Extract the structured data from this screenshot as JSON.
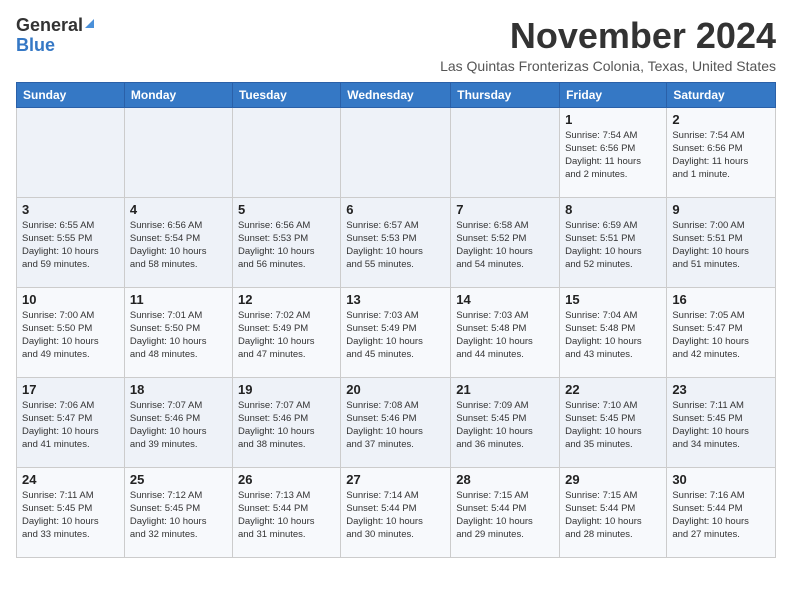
{
  "header": {
    "logo_line1": "General",
    "logo_line2": "Blue",
    "month": "November 2024",
    "location": "Las Quintas Fronterizas Colonia, Texas, United States"
  },
  "weekdays": [
    "Sunday",
    "Monday",
    "Tuesday",
    "Wednesday",
    "Thursday",
    "Friday",
    "Saturday"
  ],
  "weeks": [
    [
      {
        "day": "",
        "info": ""
      },
      {
        "day": "",
        "info": ""
      },
      {
        "day": "",
        "info": ""
      },
      {
        "day": "",
        "info": ""
      },
      {
        "day": "",
        "info": ""
      },
      {
        "day": "1",
        "info": "Sunrise: 7:54 AM\nSunset: 6:56 PM\nDaylight: 11 hours\nand 2 minutes."
      },
      {
        "day": "2",
        "info": "Sunrise: 7:54 AM\nSunset: 6:56 PM\nDaylight: 11 hours\nand 1 minute."
      }
    ],
    [
      {
        "day": "3",
        "info": "Sunrise: 6:55 AM\nSunset: 5:55 PM\nDaylight: 10 hours\nand 59 minutes."
      },
      {
        "day": "4",
        "info": "Sunrise: 6:56 AM\nSunset: 5:54 PM\nDaylight: 10 hours\nand 58 minutes."
      },
      {
        "day": "5",
        "info": "Sunrise: 6:56 AM\nSunset: 5:53 PM\nDaylight: 10 hours\nand 56 minutes."
      },
      {
        "day": "6",
        "info": "Sunrise: 6:57 AM\nSunset: 5:53 PM\nDaylight: 10 hours\nand 55 minutes."
      },
      {
        "day": "7",
        "info": "Sunrise: 6:58 AM\nSunset: 5:52 PM\nDaylight: 10 hours\nand 54 minutes."
      },
      {
        "day": "8",
        "info": "Sunrise: 6:59 AM\nSunset: 5:51 PM\nDaylight: 10 hours\nand 52 minutes."
      },
      {
        "day": "9",
        "info": "Sunrise: 7:00 AM\nSunset: 5:51 PM\nDaylight: 10 hours\nand 51 minutes."
      }
    ],
    [
      {
        "day": "10",
        "info": "Sunrise: 7:00 AM\nSunset: 5:50 PM\nDaylight: 10 hours\nand 49 minutes."
      },
      {
        "day": "11",
        "info": "Sunrise: 7:01 AM\nSunset: 5:50 PM\nDaylight: 10 hours\nand 48 minutes."
      },
      {
        "day": "12",
        "info": "Sunrise: 7:02 AM\nSunset: 5:49 PM\nDaylight: 10 hours\nand 47 minutes."
      },
      {
        "day": "13",
        "info": "Sunrise: 7:03 AM\nSunset: 5:49 PM\nDaylight: 10 hours\nand 45 minutes."
      },
      {
        "day": "14",
        "info": "Sunrise: 7:03 AM\nSunset: 5:48 PM\nDaylight: 10 hours\nand 44 minutes."
      },
      {
        "day": "15",
        "info": "Sunrise: 7:04 AM\nSunset: 5:48 PM\nDaylight: 10 hours\nand 43 minutes."
      },
      {
        "day": "16",
        "info": "Sunrise: 7:05 AM\nSunset: 5:47 PM\nDaylight: 10 hours\nand 42 minutes."
      }
    ],
    [
      {
        "day": "17",
        "info": "Sunrise: 7:06 AM\nSunset: 5:47 PM\nDaylight: 10 hours\nand 41 minutes."
      },
      {
        "day": "18",
        "info": "Sunrise: 7:07 AM\nSunset: 5:46 PM\nDaylight: 10 hours\nand 39 minutes."
      },
      {
        "day": "19",
        "info": "Sunrise: 7:07 AM\nSunset: 5:46 PM\nDaylight: 10 hours\nand 38 minutes."
      },
      {
        "day": "20",
        "info": "Sunrise: 7:08 AM\nSunset: 5:46 PM\nDaylight: 10 hours\nand 37 minutes."
      },
      {
        "day": "21",
        "info": "Sunrise: 7:09 AM\nSunset: 5:45 PM\nDaylight: 10 hours\nand 36 minutes."
      },
      {
        "day": "22",
        "info": "Sunrise: 7:10 AM\nSunset: 5:45 PM\nDaylight: 10 hours\nand 35 minutes."
      },
      {
        "day": "23",
        "info": "Sunrise: 7:11 AM\nSunset: 5:45 PM\nDaylight: 10 hours\nand 34 minutes."
      }
    ],
    [
      {
        "day": "24",
        "info": "Sunrise: 7:11 AM\nSunset: 5:45 PM\nDaylight: 10 hours\nand 33 minutes."
      },
      {
        "day": "25",
        "info": "Sunrise: 7:12 AM\nSunset: 5:45 PM\nDaylight: 10 hours\nand 32 minutes."
      },
      {
        "day": "26",
        "info": "Sunrise: 7:13 AM\nSunset: 5:44 PM\nDaylight: 10 hours\nand 31 minutes."
      },
      {
        "day": "27",
        "info": "Sunrise: 7:14 AM\nSunset: 5:44 PM\nDaylight: 10 hours\nand 30 minutes."
      },
      {
        "day": "28",
        "info": "Sunrise: 7:15 AM\nSunset: 5:44 PM\nDaylight: 10 hours\nand 29 minutes."
      },
      {
        "day": "29",
        "info": "Sunrise: 7:15 AM\nSunset: 5:44 PM\nDaylight: 10 hours\nand 28 minutes."
      },
      {
        "day": "30",
        "info": "Sunrise: 7:16 AM\nSunset: 5:44 PM\nDaylight: 10 hours\nand 27 minutes."
      }
    ]
  ]
}
